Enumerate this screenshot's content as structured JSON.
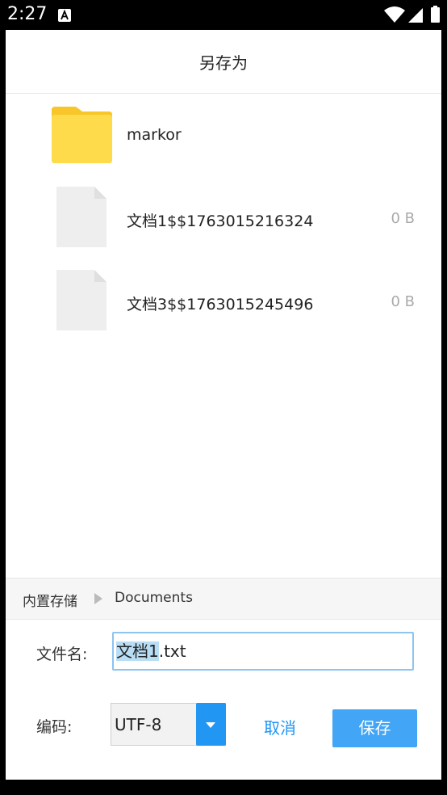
{
  "status_bar": {
    "time": "2:27"
  },
  "dialog": {
    "title": "另存为",
    "files": [
      {
        "name": "markor",
        "size": "",
        "kind": "folder"
      },
      {
        "name": "文档1$$1763015216324",
        "size": "0 B",
        "kind": "file"
      },
      {
        "name": "文档3$$1763015245496",
        "size": "0 B",
        "kind": "file"
      }
    ],
    "breadcrumb": {
      "root": "内置存储",
      "current": "Documents"
    },
    "filename": {
      "label": "文件名:",
      "selected": "文档1",
      "rest": ".txt"
    },
    "encoding": {
      "label": "编码:",
      "value": "UTF-8"
    },
    "cancel_label": "取消",
    "save_label": "保存"
  },
  "colors": {
    "accent": "#2196f3",
    "folder": "#fdd835",
    "file": "#eeeeee"
  }
}
